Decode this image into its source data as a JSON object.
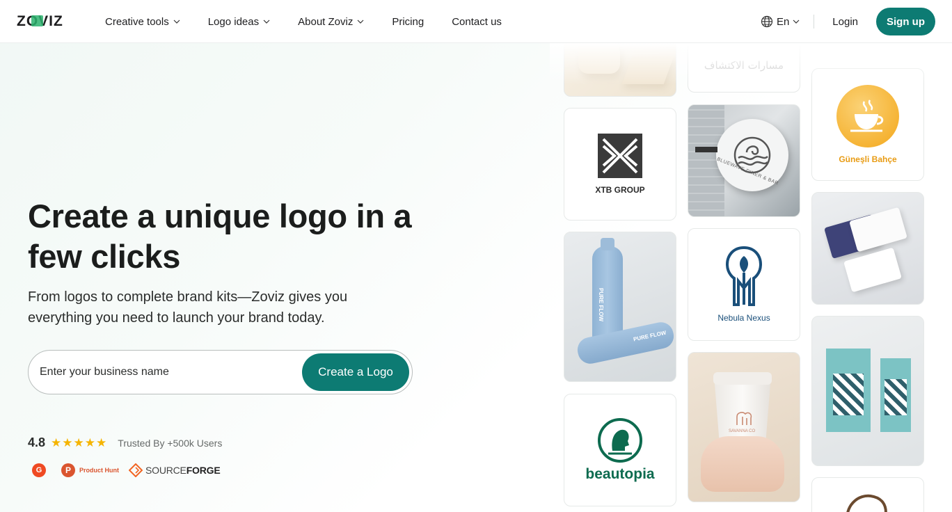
{
  "nav": {
    "brand": "ZOVIZ",
    "links": [
      {
        "label": "Creative tools",
        "dropdown": true
      },
      {
        "label": "Logo ideas",
        "dropdown": true
      },
      {
        "label": "About Zoviz",
        "dropdown": true
      },
      {
        "label": "Pricing",
        "dropdown": false
      },
      {
        "label": "Contact us",
        "dropdown": false
      }
    ],
    "language": "En",
    "login": "Login",
    "signup": "Sign up"
  },
  "hero": {
    "title": "Create a unique logo in a few clicks",
    "subtitle": "From logos to complete brand kits—Zoviz gives you everything you need to launch your brand today.",
    "input_placeholder": "Enter your business name",
    "cta": "Create a Logo"
  },
  "rating": {
    "score": "4.8",
    "stars": 5,
    "trusted": "Trusted By +500k Users"
  },
  "badges": {
    "g2": "G",
    "product_hunt": "Product Hunt",
    "sourceforge_light": "SOURCE",
    "sourceforge_bold": "FORGE"
  },
  "gallery": {
    "arabic_text": "مسارات الاكتشاف",
    "xtb": "XTB GROUP",
    "bluewave": "BLUEWAVE DINER & BAR",
    "nebula": "Nebula Nexus",
    "beautopia": "beautopia",
    "gunesli": "Güneşli Bahçe",
    "pure_flow": "PURE FLOW",
    "savanna": "SAVANNA CO"
  },
  "colors": {
    "brand": "#0d7b73",
    "star": "#f5b400"
  }
}
